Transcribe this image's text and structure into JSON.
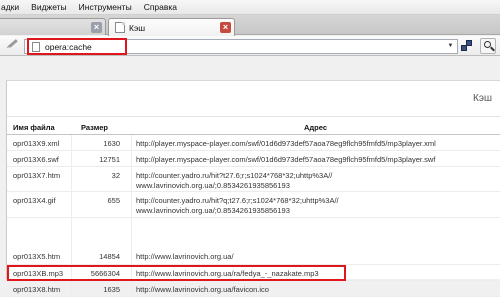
{
  "menubar": {
    "items": [
      {
        "label": "адки"
      },
      {
        "label": "Виджеты"
      },
      {
        "label": "Инструменты"
      },
      {
        "label": "Справка"
      }
    ]
  },
  "tabs": [
    {
      "title": "",
      "active": false
    },
    {
      "title": "Кэш",
      "active": true
    }
  ],
  "addressbar": {
    "url": "opera:cache"
  },
  "page": {
    "title": "Кэш"
  },
  "table": {
    "headers": [
      "Имя файла",
      "Размер",
      "Адрес"
    ],
    "rows": [
      {
        "name": "opr013X9.xml",
        "size": "1630",
        "address": "http://player.myspace-player.com/swf/01d6d973def57aoa78eg9flch95fmfd5/mp3player.xml"
      },
      {
        "name": "opr013X6.swf",
        "size": "12751",
        "address": "http://player.myspace-player.com/swf/01d6d973def57aoa78eg9flch95fmfd5/mp3player.swf"
      },
      {
        "name": "opr013X7.htm",
        "size": "32",
        "address": "http://counter.yadro.ru/hit?t27.6;r;s1024*768*32;uhttp%3A// www.lavrinovich.org.ua/;0.8534261935856193"
      },
      {
        "name": "opr013X4.gif",
        "size": "655",
        "address": "http://counter.yadro.ru/hit?q;t27.6;r;s1024*768*32;uhttp%3A// www.lavrinovich.org.ua/;0.8534261935856193"
      },
      {
        "name": "opr013X5.htm",
        "size": "14854",
        "address": "http://www.lavrinovich.org.ua/"
      },
      {
        "name": "opr013XB.mp3",
        "size": "5666304",
        "address": "http://www.lavrinovich.org.ua/ra/fedya_-_nazakate.mp3"
      },
      {
        "name": "opr013X8.htm",
        "size": "1635",
        "address": "http://www.lavrinovich.org.ua/favicon.ico"
      }
    ]
  },
  "colors": {
    "highlight_box": "#e0161d",
    "active_tab_close": "#c64a3f"
  },
  "icons": [
    "pen-icon",
    "page-icon",
    "chevron-down-icon",
    "panels-icon",
    "search-icon",
    "close-icon"
  ]
}
